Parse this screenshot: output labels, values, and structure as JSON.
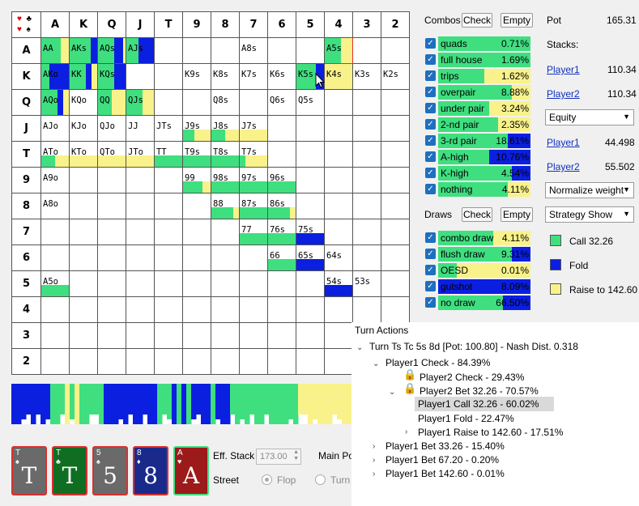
{
  "grid": {
    "corner_suits": [
      "♥",
      "♣",
      "♥",
      "♠"
    ],
    "col_headers": [
      "A",
      "K",
      "Q",
      "J",
      "T",
      "9",
      "8",
      "7",
      "6",
      "5",
      "4",
      "3",
      "2"
    ],
    "row_headers": [
      "A",
      "K",
      "Q",
      "J",
      "T",
      "9",
      "8",
      "7",
      "6",
      "5",
      "4",
      "3",
      "2"
    ],
    "cells": [
      {
        "r": 0,
        "c": 0,
        "label": "AA",
        "mix": [
          0.7,
          0,
          0.3
        ]
      },
      {
        "r": 0,
        "c": 1,
        "label": "AKs",
        "mix": [
          0.75,
          0.25,
          0
        ]
      },
      {
        "r": 0,
        "c": 2,
        "label": "AQs",
        "mix": [
          0.6,
          0.3,
          0.1
        ]
      },
      {
        "r": 0,
        "c": 3,
        "label": "AJs",
        "mix": [
          0.45,
          0.55,
          0
        ]
      },
      {
        "r": 0,
        "c": 7,
        "label": "A8s",
        "mix": null
      },
      {
        "r": 0,
        "c": 10,
        "label": "A5s",
        "mix": [
          0.6,
          0,
          0.4
        ],
        "highlight": true
      },
      {
        "r": 1,
        "c": 0,
        "label": "AKo",
        "mix": [
          0.3,
          0.7,
          0
        ]
      },
      {
        "r": 1,
        "c": 1,
        "label": "KK",
        "mix": [
          0.6,
          0.2,
          0.2
        ]
      },
      {
        "r": 1,
        "c": 2,
        "label": "KQs",
        "mix": [
          0.6,
          0.4,
          0
        ]
      },
      {
        "r": 1,
        "c": 5,
        "label": "K9s",
        "mix": null
      },
      {
        "r": 1,
        "c": 6,
        "label": "K8s",
        "mix": null
      },
      {
        "r": 1,
        "c": 7,
        "label": "K7s",
        "mix": null
      },
      {
        "r": 1,
        "c": 8,
        "label": "K6s",
        "mix": null
      },
      {
        "r": 1,
        "c": 9,
        "label": "K5s",
        "mix": [
          0.7,
          0.3,
          0
        ]
      },
      {
        "r": 1,
        "c": 10,
        "label": "K4s",
        "mix": [
          0,
          0,
          1
        ]
      },
      {
        "r": 1,
        "c": 11,
        "label": "K3s",
        "mix": null
      },
      {
        "r": 1,
        "c": 12,
        "label": "K2s",
        "mix": null
      },
      {
        "r": 2,
        "c": 0,
        "label": "AQo",
        "mix": [
          0.6,
          0.2,
          0.2
        ]
      },
      {
        "r": 2,
        "c": 1,
        "label": "KQo",
        "mix": null
      },
      {
        "r": 2,
        "c": 2,
        "label": "QQ",
        "mix": [
          0.5,
          0,
          0.5
        ]
      },
      {
        "r": 2,
        "c": 3,
        "label": "QJs",
        "mix": [
          0.6,
          0,
          0.4
        ]
      },
      {
        "r": 2,
        "c": 6,
        "label": "Q8s",
        "mix": null
      },
      {
        "r": 2,
        "c": 8,
        "label": "Q6s",
        "mix": null
      },
      {
        "r": 2,
        "c": 9,
        "label": "Q5s",
        "mix": null
      },
      {
        "r": 3,
        "c": 0,
        "label": "AJo",
        "mix": null
      },
      {
        "r": 3,
        "c": 1,
        "label": "KJo",
        "mix": null
      },
      {
        "r": 3,
        "c": 2,
        "label": "QJo",
        "mix": null
      },
      {
        "r": 3,
        "c": 3,
        "label": "JJ",
        "mix": null
      },
      {
        "r": 3,
        "c": 4,
        "label": "JTs",
        "mix": null
      },
      {
        "r": 3,
        "c": 5,
        "label": "J9s",
        "mix": [
          0.4,
          0,
          0.6
        ]
      },
      {
        "r": 3,
        "c": 6,
        "label": "J8s",
        "mix": [
          0.5,
          0,
          0.5
        ]
      },
      {
        "r": 3,
        "c": 7,
        "label": "J7s",
        "mix": [
          0,
          0,
          1
        ]
      },
      {
        "r": 4,
        "c": 0,
        "label": "ATo",
        "mix": [
          0.5,
          0,
          0.5
        ]
      },
      {
        "r": 4,
        "c": 1,
        "label": "KTo",
        "mix": [
          0,
          0,
          1
        ]
      },
      {
        "r": 4,
        "c": 2,
        "label": "QTo",
        "mix": [
          0,
          0,
          1
        ]
      },
      {
        "r": 4,
        "c": 3,
        "label": "JTo",
        "mix": [
          0,
          0,
          1
        ]
      },
      {
        "r": 4,
        "c": 4,
        "label": "TT",
        "mix": [
          1,
          0,
          0
        ]
      },
      {
        "r": 4,
        "c": 5,
        "label": "T9s",
        "mix": [
          1,
          0,
          0
        ]
      },
      {
        "r": 4,
        "c": 6,
        "label": "T8s",
        "mix": [
          1,
          0,
          0
        ]
      },
      {
        "r": 4,
        "c": 7,
        "label": "T7s",
        "mix": [
          0.2,
          0,
          0.8
        ]
      },
      {
        "r": 5,
        "c": 0,
        "label": "A9o",
        "mix": null
      },
      {
        "r": 5,
        "c": 5,
        "label": "99",
        "mix": [
          0.7,
          0,
          0.3
        ]
      },
      {
        "r": 5,
        "c": 6,
        "label": "98s",
        "mix": [
          1,
          0,
          0
        ]
      },
      {
        "r": 5,
        "c": 7,
        "label": "97s",
        "mix": [
          1,
          0,
          0
        ]
      },
      {
        "r": 5,
        "c": 8,
        "label": "96s",
        "mix": [
          1,
          0,
          0
        ]
      },
      {
        "r": 6,
        "c": 0,
        "label": "A8o",
        "mix": null
      },
      {
        "r": 6,
        "c": 6,
        "label": "88",
        "mix": [
          0.8,
          0,
          0.2
        ]
      },
      {
        "r": 6,
        "c": 7,
        "label": "87s",
        "mix": [
          1,
          0,
          0
        ]
      },
      {
        "r": 6,
        "c": 8,
        "label": "86s",
        "mix": [
          0.8,
          0,
          0.2
        ]
      },
      {
        "r": 7,
        "c": 7,
        "label": "77",
        "mix": [
          1,
          0,
          0
        ]
      },
      {
        "r": 7,
        "c": 8,
        "label": "76s",
        "mix": [
          1,
          0,
          0
        ]
      },
      {
        "r": 7,
        "c": 9,
        "label": "75s",
        "mix": [
          0,
          1,
          0
        ]
      },
      {
        "r": 8,
        "c": 8,
        "label": "66",
        "mix": [
          1,
          0,
          0
        ]
      },
      {
        "r": 8,
        "c": 9,
        "label": "65s",
        "mix": [
          0,
          1,
          0
        ]
      },
      {
        "r": 8,
        "c": 10,
        "label": "64s",
        "mix": null
      },
      {
        "r": 9,
        "c": 0,
        "label": "A5o",
        "mix": [
          1,
          0,
          0
        ]
      },
      {
        "r": 9,
        "c": 10,
        "label": "54s",
        "mix": [
          0,
          1,
          0
        ]
      },
      {
        "r": 9,
        "c": 11,
        "label": "53s",
        "mix": null
      }
    ]
  },
  "colors": {
    "call": "#3fdf80",
    "fold": "#0a1fe0",
    "raise": "#f9f28a"
  },
  "strip_pattern": "BBBBBBBBGGGYGYGGGGGBBBBBBBBBBBGGGBGBGBBBBGBBBGGGGGGGGGGGGGGYYYYYYYYYYY",
  "cards": [
    {
      "rank": "T",
      "suit": "♠",
      "bg": "#6a6a6a",
      "border": "#d93030"
    },
    {
      "rank": "T",
      "suit": "♣",
      "bg": "#0f6e22",
      "border": "#d93030"
    },
    {
      "rank": "5",
      "suit": "♠",
      "bg": "#6a6a6a",
      "border": "#d93030"
    },
    {
      "rank": "8",
      "suit": "♦",
      "bg": "#1a2a8a",
      "border": "#d93030"
    },
    {
      "rank": "A",
      "suit": "♥",
      "bg": "#9c1a1a",
      "border": "#3fdf80"
    }
  ],
  "bottom": {
    "eff_stack_label": "Eff. Stack",
    "eff_stack_value": "173.00",
    "main_pot_label": "Main Pot",
    "street_label": "Street",
    "flop": "Flop",
    "turn": "Turn"
  },
  "combos": {
    "title": "Combos",
    "check": "Check",
    "empty": "Empty",
    "rows": [
      {
        "name": "quads",
        "pct": "0.71%",
        "mix": [
          1,
          0,
          0
        ]
      },
      {
        "name": "full house",
        "pct": "1.69%",
        "mix": [
          1,
          0,
          0
        ]
      },
      {
        "name": "trips",
        "pct": "1.62%",
        "mix": [
          0.5,
          0,
          0.5
        ]
      },
      {
        "name": "overpair",
        "pct": "8.88%",
        "mix": [
          0.8,
          0,
          0.2
        ]
      },
      {
        "name": "under pair",
        "pct": "3.24%",
        "mix": [
          0.55,
          0,
          0.45
        ]
      },
      {
        "name": "2-nd pair",
        "pct": "2.35%",
        "mix": [
          0.65,
          0,
          0.35
        ]
      },
      {
        "name": "3-rd pair",
        "pct": "18.61%",
        "mix": [
          0.75,
          0.25,
          0
        ]
      },
      {
        "name": "A-high",
        "pct": "10.76%",
        "mix": [
          0.55,
          0.45,
          0
        ]
      },
      {
        "name": "K-high",
        "pct": "4.54%",
        "mix": [
          0.8,
          0.2,
          0
        ]
      },
      {
        "name": "nothing",
        "pct": "4.11%",
        "mix": [
          0.75,
          0,
          0.25
        ]
      }
    ]
  },
  "draws": {
    "title": "Draws",
    "check": "Check",
    "empty": "Empty",
    "rows": [
      {
        "name": "combo draw",
        "pct": "4.11%",
        "mix": [
          0.6,
          0,
          0.4
        ]
      },
      {
        "name": "flush draw",
        "pct": "9.31%",
        "mix": [
          0.8,
          0.2,
          0
        ]
      },
      {
        "name": "OESD",
        "pct": "0.01%",
        "mix": [
          0.2,
          0,
          0.8
        ]
      },
      {
        "name": "gutshot",
        "pct": "8.09%",
        "mix": [
          0,
          1,
          0
        ]
      },
      {
        "name": "no draw",
        "pct": "66.50%",
        "mix": [
          0.7,
          0.3,
          0
        ]
      }
    ]
  },
  "info": {
    "pot_label": "Pot",
    "pot_value": "165.31",
    "stacks_label": "Stacks:",
    "p1": "Player1",
    "p1_stack": "110.34",
    "p2": "Player2",
    "p2_stack": "110.34",
    "equity_select": "Equity",
    "p1_equity": "44.498",
    "p2_equity": "55.502",
    "norm_select": "Normalize weight",
    "strat_select": "Strategy Show",
    "legend_call": "Call 32.26",
    "legend_fold": "Fold",
    "legend_raise": "Raise to 142.60"
  },
  "tree": {
    "title": "Turn Actions",
    "nodes": [
      "Turn Ts Tc 5s 8d [Pot: 100.80] - Nash Dist. 0.318",
      "Player1 Check - 84.39%",
      "Player2 Check - 29.43%",
      "Player2 Bet 32.26 - 70.57%",
      "Player1 Call 32.26 - 60.02%",
      "Player1 Fold - 22.47%",
      "Player1 Raise to 142.60 - 17.51%",
      "Player1 Bet 33.26 - 15.40%",
      "Player1 Bet 67.20 - 0.20%",
      "Player1 Bet 142.60 - 0.01%"
    ]
  }
}
